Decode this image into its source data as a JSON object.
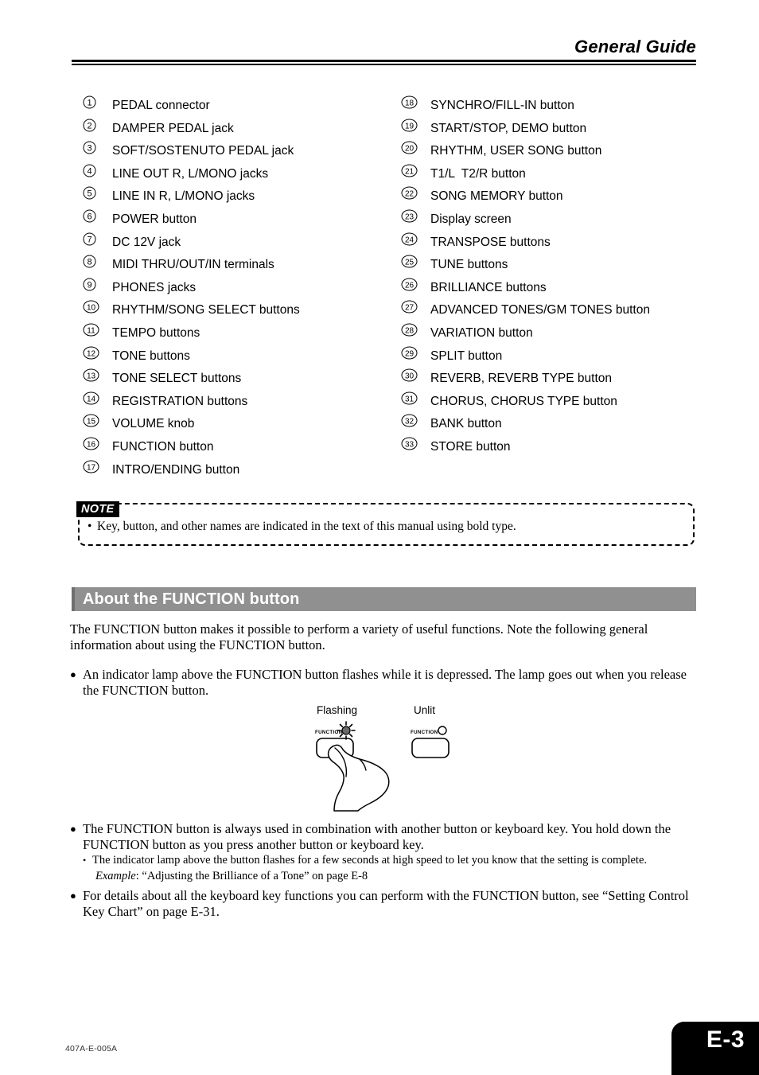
{
  "header": {
    "title": "General Guide"
  },
  "legend": {
    "left_column": [
      {
        "num": "1",
        "label": "PEDAL connector"
      },
      {
        "num": "2",
        "label": "DAMPER PEDAL jack"
      },
      {
        "num": "3",
        "label": "SOFT/SOSTENUTO PEDAL jack"
      },
      {
        "num": "4",
        "label": "LINE OUT R, L/MONO jacks"
      },
      {
        "num": "5",
        "label": "LINE IN R, L/MONO jacks"
      },
      {
        "num": "6",
        "label": "POWER button"
      },
      {
        "num": "7",
        "label": "DC 12V jack"
      },
      {
        "num": "8",
        "label": "MIDI THRU/OUT/IN terminals"
      },
      {
        "num": "9",
        "label": "PHONES jacks"
      },
      {
        "num": "10",
        "label": "RHYTHM/SONG SELECT buttons"
      },
      {
        "num": "11",
        "label": "TEMPO buttons"
      },
      {
        "num": "12",
        "label": "TONE buttons"
      },
      {
        "num": "13",
        "label": "TONE SELECT buttons"
      },
      {
        "num": "14",
        "label": "REGISTRATION buttons"
      },
      {
        "num": "15",
        "label": "VOLUME knob"
      },
      {
        "num": "16",
        "label": "FUNCTION button"
      },
      {
        "num": "17",
        "label": "INTRO/ENDING button"
      }
    ],
    "right_column": [
      {
        "num": "18",
        "label": "SYNCHRO/FILL-IN button"
      },
      {
        "num": "19",
        "label": "START/STOP, DEMO button"
      },
      {
        "num": "20",
        "label": "RHYTHM, USER SONG button"
      },
      {
        "num": "21",
        "label": "T1/L  T2/R button"
      },
      {
        "num": "22",
        "label": "SONG MEMORY button"
      },
      {
        "num": "23",
        "label": "Display screen"
      },
      {
        "num": "24",
        "label": "TRANSPOSE buttons"
      },
      {
        "num": "25",
        "label": "TUNE buttons"
      },
      {
        "num": "26",
        "label": "BRILLIANCE buttons"
      },
      {
        "num": "27",
        "label": "ADVANCED TONES/GM TONES button"
      },
      {
        "num": "28",
        "label": "VARIATION button"
      },
      {
        "num": "29",
        "label": "SPLIT button"
      },
      {
        "num": "30",
        "label": "REVERB, REVERB TYPE button"
      },
      {
        "num": "31",
        "label": "CHORUS, CHORUS TYPE button"
      },
      {
        "num": "32",
        "label": "BANK button"
      },
      {
        "num": "33",
        "label": "STORE button"
      }
    ]
  },
  "note": {
    "tag": "NOTE",
    "bullet": "•",
    "text": "Key, button, and other names are indicated in the text of this manual using bold type."
  },
  "section": {
    "heading": "About the FUNCTION button",
    "intro": "The FUNCTION button makes it possible to perform a variety of useful functions. Note the following general information about using the FUNCTION button.",
    "bullets": [
      {
        "marker": "●",
        "text": "An indicator lamp above the FUNCTION button flashes while it is depressed. The lamp goes out when you release the FUNCTION button."
      },
      {
        "marker": "●",
        "text": "The FUNCTION button is always used in combination with another button or keyboard key. You hold down the FUNCTION button as you press another button or keyboard key.",
        "sub": [
          {
            "marker": "•",
            "text": "The indicator lamp above the button flashes for a few seconds at high speed to let you know that the setting is complete."
          }
        ],
        "example_label": "Example",
        "example_text": ": “Adjusting the Brilliance of a Tone” on page E-8"
      },
      {
        "marker": "●",
        "text": "For details about all the keyboard key functions you can perform with the FUNCTION button, see “Setting Control Key Chart” on page E-31."
      }
    ]
  },
  "illustration": {
    "caption_left": "Flashing",
    "caption_right": "Unlit",
    "button_label_left": "FUNCTION",
    "button_label_right": "FUNCTION"
  },
  "footer": {
    "doc_code": "407A-E-005A",
    "page_number": "E-3"
  },
  "colors": {
    "banner_gray": "#909090",
    "banner_edge": "#6f6f6f",
    "text_black": "#000000",
    "tab_black": "#000000"
  }
}
